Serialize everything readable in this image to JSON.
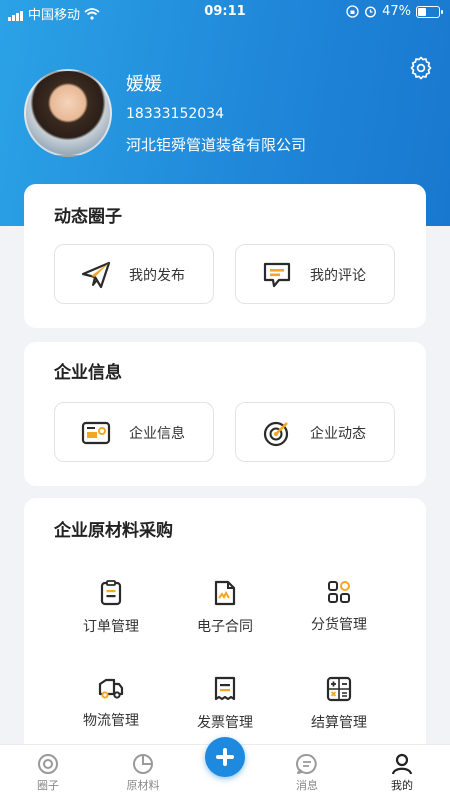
{
  "status_bar": {
    "carrier": "中国移动",
    "time": "09:11",
    "battery": "47%",
    "battery_level": 0.47
  },
  "profile": {
    "name": "媛媛",
    "phone": "18333152034",
    "company": "河北钜舜管道装备有限公司"
  },
  "sections": {
    "moments": {
      "title": "动态圈子",
      "items": [
        {
          "label": "我的发布",
          "icon": "paper-plane-icon"
        },
        {
          "label": "我的评论",
          "icon": "comment-icon"
        }
      ]
    },
    "enterprise": {
      "title": "企业信息",
      "items": [
        {
          "label": "企业信息",
          "icon": "id-card-icon"
        },
        {
          "label": "企业动态",
          "icon": "radar-icon"
        }
      ]
    },
    "procurement": {
      "title": "企业原材料采购",
      "items": [
        {
          "label": "订单管理",
          "icon": "clipboard-icon"
        },
        {
          "label": "电子合同",
          "icon": "contract-icon"
        },
        {
          "label": "分货管理",
          "icon": "grid-icon"
        },
        {
          "label": "物流管理",
          "icon": "truck-icon"
        },
        {
          "label": "发票管理",
          "icon": "receipt-icon"
        },
        {
          "label": "结算管理",
          "icon": "calculator-icon"
        }
      ]
    }
  },
  "tabbar": {
    "items": [
      {
        "label": "圈子"
      },
      {
        "label": "原材料"
      },
      {
        "label": "消息"
      },
      {
        "label": "我的"
      }
    ],
    "active": "我的"
  },
  "colors": {
    "brand_blue": "#1d8ae0",
    "accent_orange": "#f5a623"
  }
}
